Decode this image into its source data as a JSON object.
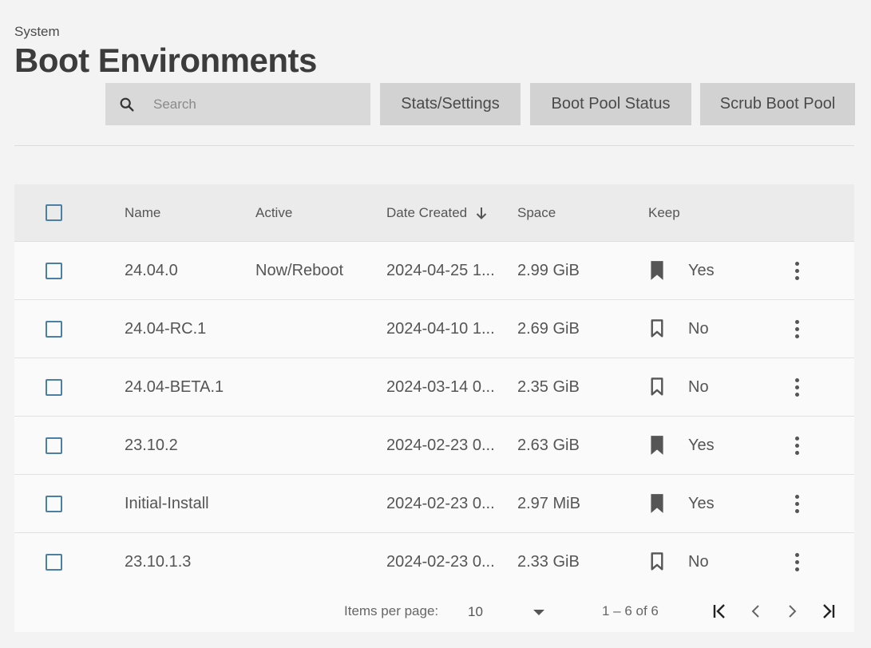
{
  "header": {
    "breadcrumb": "System",
    "title": "Boot Environments"
  },
  "toolbar": {
    "search_placeholder": "Search",
    "buttons": [
      "Stats/Settings",
      "Boot Pool Status",
      "Scrub Boot Pool"
    ]
  },
  "table": {
    "columns": {
      "name": "Name",
      "active": "Active",
      "date_created": "Date Created",
      "space": "Space",
      "keep": "Keep"
    },
    "sort": {
      "column": "Date Created",
      "direction": "descending",
      "icon": "arrow-down-icon"
    },
    "rows": [
      {
        "name": "24.04.0",
        "active": "Now/Reboot",
        "date": "2024-04-25 1...",
        "space": "2.99 GiB",
        "keep": "Yes",
        "keep_icon": "bookmark-filled-icon"
      },
      {
        "name": "24.04-RC.1",
        "active": "",
        "date": "2024-04-10 1...",
        "space": "2.69 GiB",
        "keep": "No",
        "keep_icon": "bookmark-outline-icon"
      },
      {
        "name": "24.04-BETA.1",
        "active": "",
        "date": "2024-03-14 0...",
        "space": "2.35 GiB",
        "keep": "No",
        "keep_icon": "bookmark-outline-icon"
      },
      {
        "name": "23.10.2",
        "active": "",
        "date": "2024-02-23 0...",
        "space": "2.63 GiB",
        "keep": "Yes",
        "keep_icon": "bookmark-filled-icon"
      },
      {
        "name": "Initial-Install",
        "active": "",
        "date": "2024-02-23 0...",
        "space": "2.97 MiB",
        "keep": "Yes",
        "keep_icon": "bookmark-filled-icon"
      },
      {
        "name": "23.10.1.3",
        "active": "",
        "date": "2024-02-23 0...",
        "space": "2.33 GiB",
        "keep": "No",
        "keep_icon": "bookmark-outline-icon"
      }
    ]
  },
  "paginator": {
    "items_per_page_label": "Items per page:",
    "items_per_page": "10",
    "range": "1 – 6 of 6"
  },
  "colors": {
    "background": "#f3f3f3",
    "checkbox_border": "#4b7fa3",
    "button_bg": "#d2d2d2",
    "search_bg": "#d9d9d9",
    "header_bg": "#ebebeb"
  }
}
